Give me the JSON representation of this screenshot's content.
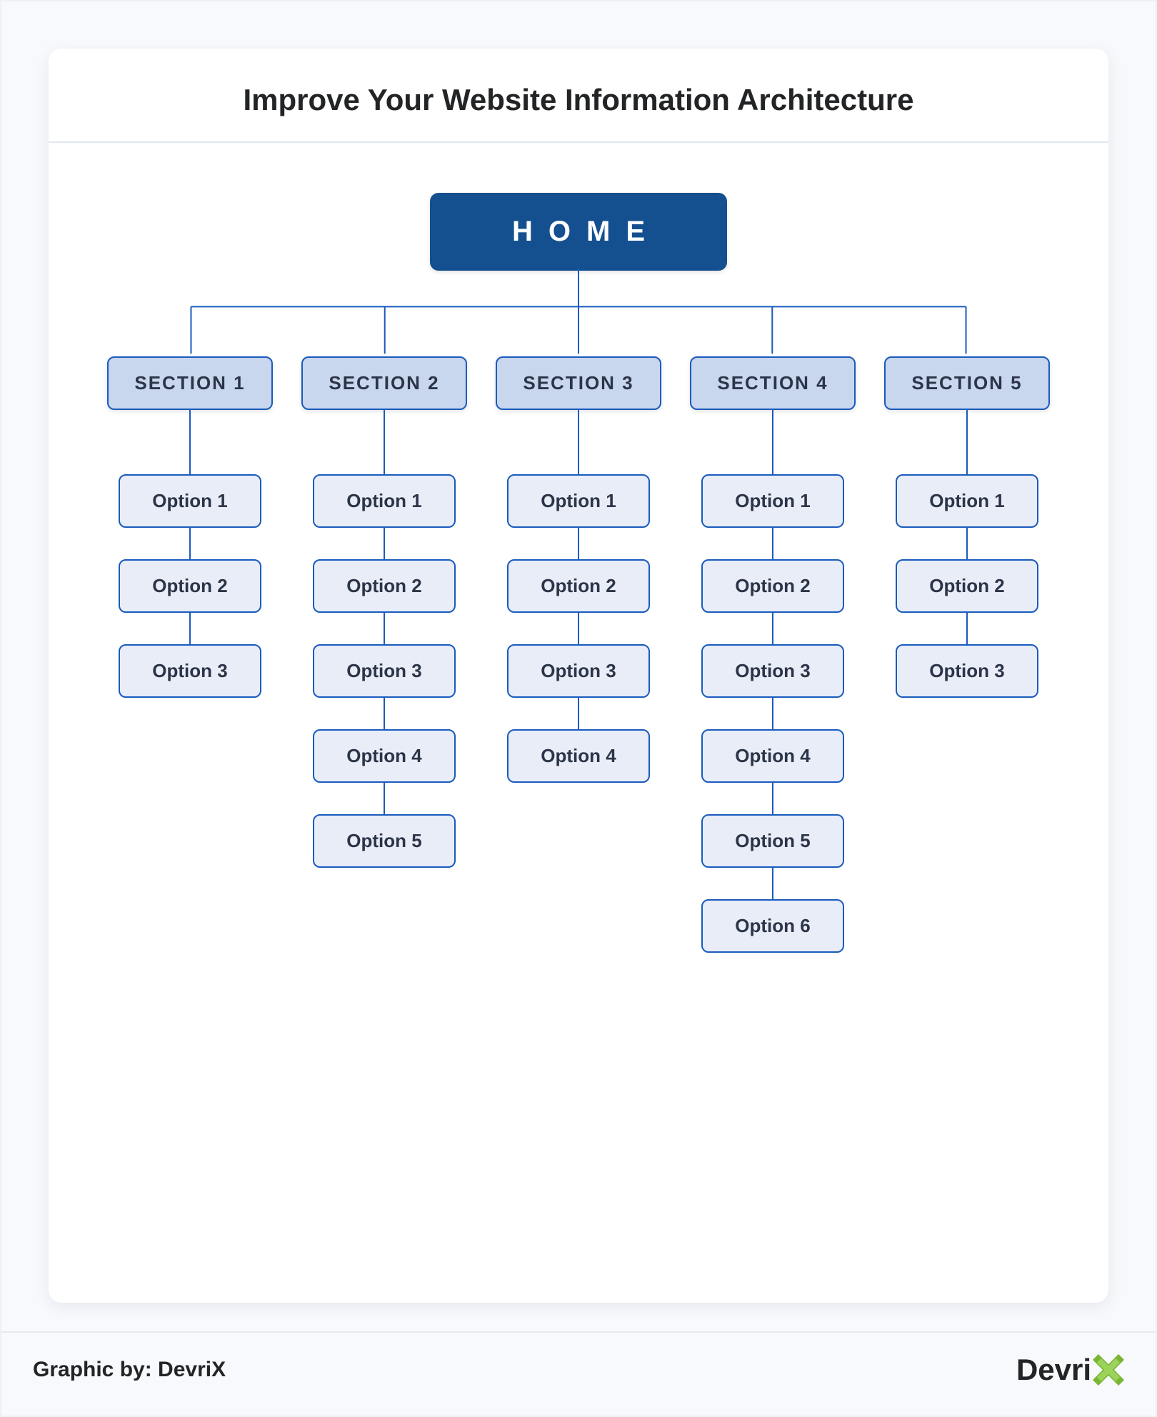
{
  "title": "Improve Your Website Information Architecture",
  "home": "HOME",
  "sections": [
    {
      "label": "SECTION 1",
      "options": [
        "Option 1",
        "Option 2",
        "Option 3"
      ]
    },
    {
      "label": "SECTION 2",
      "options": [
        "Option 1",
        "Option 2",
        "Option 3",
        "Option 4",
        "Option 5"
      ]
    },
    {
      "label": "SECTION 3",
      "options": [
        "Option 1",
        "Option 2",
        "Option 3",
        "Option 4"
      ]
    },
    {
      "label": "SECTION 4",
      "options": [
        "Option 1",
        "Option 2",
        "Option 3",
        "Option 4",
        "Option 5",
        "Option 6"
      ]
    },
    {
      "label": "SECTION 5",
      "options": [
        "Option 1",
        "Option 2",
        "Option 3"
      ]
    }
  ],
  "footer": {
    "credit": "Graphic by: DevriX",
    "brand": "Devri"
  }
}
